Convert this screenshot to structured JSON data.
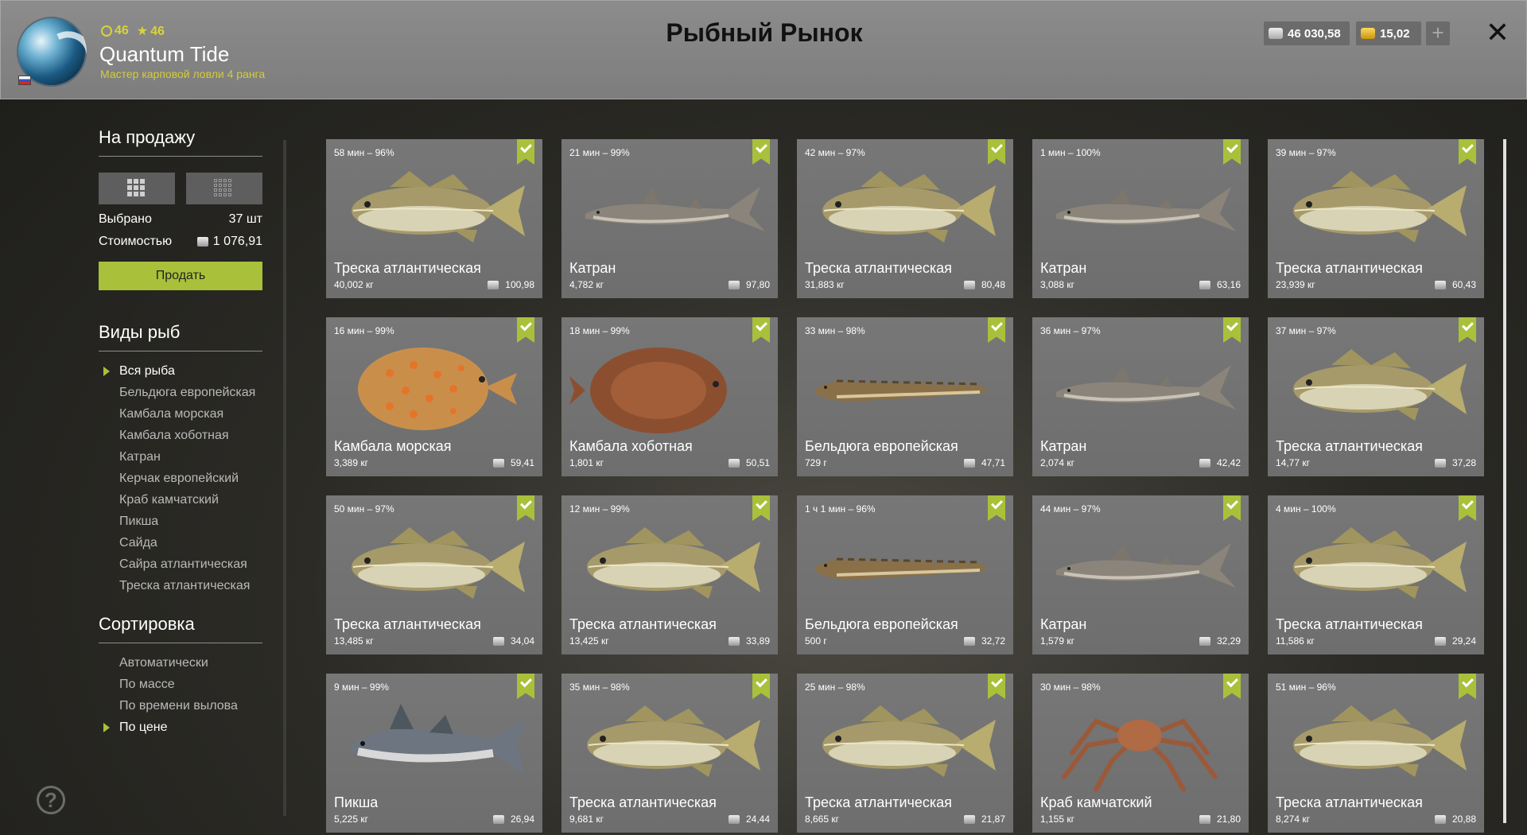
{
  "header": {
    "title": "Рыбный Рынок",
    "player": {
      "name": "Quantum Tide",
      "rank": "Мастер карповой ловли 4 ранга",
      "level": "46",
      "stars": "46"
    },
    "silver": "46 030,58",
    "gold": "15,02",
    "add_label": "+",
    "close_label": "✕"
  },
  "sidebar": {
    "sale_title": "На продажу",
    "selected_label": "Выбрано",
    "selected_value": "37 шт",
    "cost_label": "Стоимостью",
    "cost_value": "1 076,91",
    "sell_button": "Продать",
    "species_title": "Виды рыб",
    "species": [
      "Вся рыба",
      "Бельдюга европейская",
      "Камбала морская",
      "Камбала хоботная",
      "Катран",
      "Керчак европейский",
      "Краб камчатский",
      "Пикша",
      "Сайда",
      "Сайра атлантическая",
      "Треска атлантическая"
    ],
    "sort_title": "Сортировка",
    "sort": [
      "Автоматически",
      "По массе",
      "По времени вылова",
      "По цене"
    ],
    "help_label": "?"
  },
  "cards": [
    {
      "time": "58 мин – 96%",
      "name": "Треска атлантическая",
      "weight": "40,002 кг",
      "price": "100,98",
      "kind": "cod"
    },
    {
      "time": "21 мин – 99%",
      "name": "Катран",
      "weight": "4,782 кг",
      "price": "97,80",
      "kind": "shark"
    },
    {
      "time": "42 мин – 97%",
      "name": "Треска атлантическая",
      "weight": "31,883 кг",
      "price": "80,48",
      "kind": "cod"
    },
    {
      "time": "1 мин – 100%",
      "name": "Катран",
      "weight": "3,088 кг",
      "price": "63,16",
      "kind": "shark"
    },
    {
      "time": "39 мин – 97%",
      "name": "Треска атлантическая",
      "weight": "23,939 кг",
      "price": "60,43",
      "kind": "cod"
    },
    {
      "time": "16 мин – 99%",
      "name": "Камбала морская",
      "weight": "3,389 кг",
      "price": "59,41",
      "kind": "plaice"
    },
    {
      "time": "18 мин – 99%",
      "name": "Камбала хоботная",
      "weight": "1,801 кг",
      "price": "50,51",
      "kind": "flounder"
    },
    {
      "time": "33 мин – 98%",
      "name": "Бельдюга европейская",
      "weight": "729 г",
      "price": "47,71",
      "kind": "eelpout"
    },
    {
      "time": "36 мин – 97%",
      "name": "Катран",
      "weight": "2,074 кг",
      "price": "42,42",
      "kind": "shark"
    },
    {
      "time": "37 мин – 97%",
      "name": "Треска атлантическая",
      "weight": "14,77 кг",
      "price": "37,28",
      "kind": "cod"
    },
    {
      "time": "50 мин – 97%",
      "name": "Треска атлантическая",
      "weight": "13,485 кг",
      "price": "34,04",
      "kind": "cod"
    },
    {
      "time": "12 мин – 99%",
      "name": "Треска атлантическая",
      "weight": "13,425 кг",
      "price": "33,89",
      "kind": "cod"
    },
    {
      "time": "1 ч 1 мин – 96%",
      "name": "Бельдюга европейская",
      "weight": "500 г",
      "price": "32,72",
      "kind": "eelpout"
    },
    {
      "time": "44 мин – 97%",
      "name": "Катран",
      "weight": "1,579 кг",
      "price": "32,29",
      "kind": "shark"
    },
    {
      "time": "4 мин – 100%",
      "name": "Треска атлантическая",
      "weight": "11,586 кг",
      "price": "29,24",
      "kind": "cod"
    },
    {
      "time": "9 мин – 99%",
      "name": "Пикша",
      "weight": "5,225 кг",
      "price": "26,94",
      "kind": "haddock"
    },
    {
      "time": "35 мин – 98%",
      "name": "Треска атлантическая",
      "weight": "9,681 кг",
      "price": "24,44",
      "kind": "cod"
    },
    {
      "time": "25 мин – 98%",
      "name": "Треска атлантическая",
      "weight": "8,665 кг",
      "price": "21,87",
      "kind": "cod"
    },
    {
      "time": "30 мин – 98%",
      "name": "Краб камчатский",
      "weight": "1,155 кг",
      "price": "21,80",
      "kind": "crab"
    },
    {
      "time": "51 мин – 96%",
      "name": "Треска атлантическая",
      "weight": "8,274 кг",
      "price": "20,88",
      "kind": "cod"
    }
  ]
}
